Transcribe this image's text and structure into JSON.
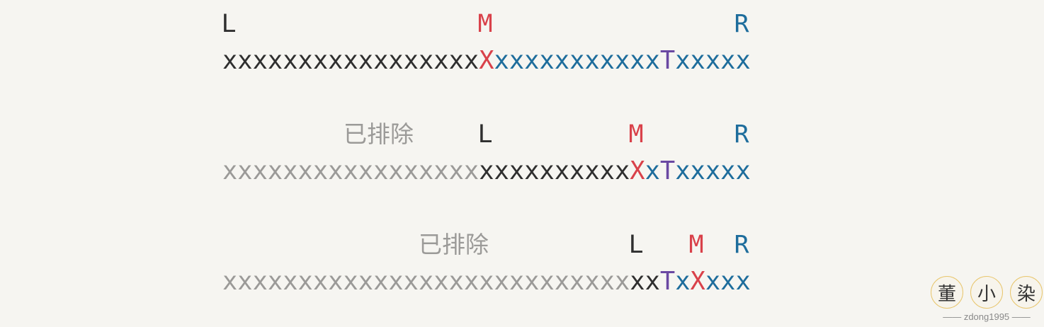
{
  "stages": [
    {
      "markers": {
        "L": "L",
        "M": "M",
        "R": "R"
      },
      "excluded_label": "",
      "segments": [
        {
          "text": "xxxxxxxxxxxxxxxxx",
          "role": "active"
        },
        {
          "text": "X",
          "role": "mid"
        },
        {
          "text": "xxxxxxxxxxx",
          "role": "right"
        },
        {
          "text": "T",
          "role": "target"
        },
        {
          "text": "xxxxx",
          "role": "right"
        }
      ]
    },
    {
      "markers": {
        "L": "L",
        "M": "M",
        "R": "R"
      },
      "excluded_label": "已排除",
      "segments": [
        {
          "text": "xxxxxxxxxxxxxxxxx",
          "role": "excluded"
        },
        {
          "text": "xxxxxxxxxx",
          "role": "active"
        },
        {
          "text": "X",
          "role": "mid"
        },
        {
          "text": "x",
          "role": "right"
        },
        {
          "text": "T",
          "role": "target"
        },
        {
          "text": "xxxxx",
          "role": "right"
        }
      ]
    },
    {
      "markers": {
        "L": "L",
        "M": "M",
        "R": "R"
      },
      "excluded_label": "已排除",
      "segments": [
        {
          "text": "xxxxxxxxxxxxxxxxxxxxxxxxxxx",
          "role": "excluded"
        },
        {
          "text": "xx",
          "role": "active"
        },
        {
          "text": "T",
          "role": "target"
        },
        {
          "text": "x",
          "role": "right"
        },
        {
          "text": "X",
          "role": "mid"
        },
        {
          "text": "xxx",
          "role": "right"
        }
      ]
    }
  ],
  "watermark": {
    "seal_chars": [
      "董",
      "小",
      "染"
    ],
    "signature": "—— zdong1995 ——"
  },
  "colors": {
    "excluded": "#9b9a98",
    "active": "#2f2f2f",
    "mid": "#d9414a",
    "right": "#1e6d9c",
    "target": "#6a48a2",
    "background": "#f6f5f1"
  }
}
